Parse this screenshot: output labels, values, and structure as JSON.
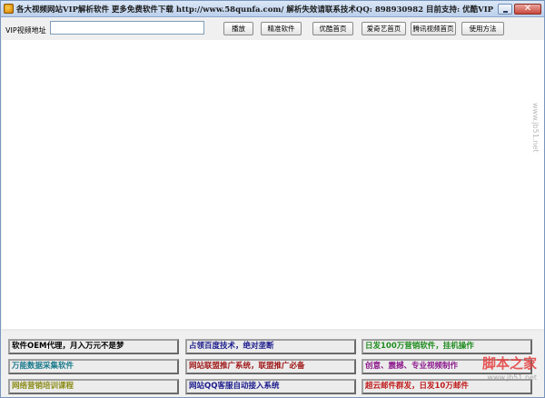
{
  "window": {
    "title": "各大视频网站VIP解析软件 更多免费软件下载 http://www.58qunfa.com/ 解析失效请联系技术QQ: 898930982 目前支持: 优酷VIP 芒果vip...",
    "close_label": "✕"
  },
  "toolbar": {
    "url_label": "VIP视频地址",
    "url_value": "",
    "buttons": [
      {
        "label": "播放"
      },
      {
        "label": "精准软件"
      },
      {
        "label": "优酷首页"
      },
      {
        "label": "爱奇艺首页"
      },
      {
        "label": "腾讯视频首页"
      },
      {
        "label": "使用方法"
      }
    ]
  },
  "ads": [
    {
      "text": "软件OEM代理，月入万元不是梦",
      "color": "#000000"
    },
    {
      "text": "占领百度技术，绝对垄断",
      "color": "#1a1a8c"
    },
    {
      "text": "日发100万营销软件，挂机操作",
      "color": "#1f8c1f"
    },
    {
      "text": "万能数据采集软件",
      "color": "#1a7a8c"
    },
    {
      "text": "网站联盟推广系统，联盟推广必备",
      "color": "#a01a1a"
    },
    {
      "text": "创意、震撼、专业视频制作",
      "color": "#8c1a8c"
    },
    {
      "text": "网络营销培训课程",
      "color": "#8c8c1a"
    },
    {
      "text": "网站QQ客服自动接入系统",
      "color": "#1a1a8c"
    },
    {
      "text": "超云邮件群发，日发10万邮件",
      "color": "#c01a1a"
    }
  ],
  "watermark": {
    "site_cn": "脚本之家",
    "site_url": "www.jb51.net"
  },
  "icons": {
    "app": "app-icon",
    "minimize": "minimize-icon",
    "close": "close-icon"
  }
}
